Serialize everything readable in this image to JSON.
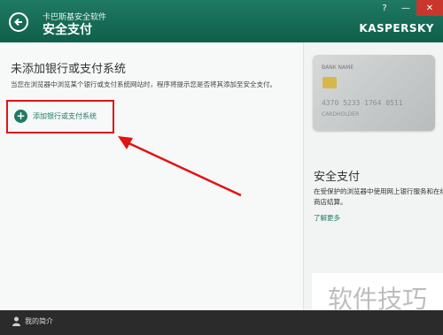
{
  "titlebar": {
    "subtitle": "卡巴斯基安全软件",
    "title": "安全支付",
    "brand": "KASPERSKY",
    "controls": [
      "?",
      "—",
      "✕"
    ]
  },
  "main": {
    "heading": "未添加银行或支付系统",
    "description": "当您在浏览器中浏览某个银行或支付系统网站时，程序将提示您是否将其添加至安全支付。",
    "add_button_label": "添加银行或支付系统"
  },
  "side": {
    "card": {
      "name": "BANK NAME",
      "number": "4370 5233 1764 0511",
      "holder": "CARDHOLDER"
    },
    "title": "安全支付",
    "description": "在受保护的浏览器中使用网上银行服务和在线商店结算。",
    "learn_more": "了解更多"
  },
  "bottom": {
    "profile_label": "我的简介"
  },
  "watermark": "软件技巧",
  "colors": {
    "accent": "#1f7a63",
    "highlight": "#e01414"
  }
}
